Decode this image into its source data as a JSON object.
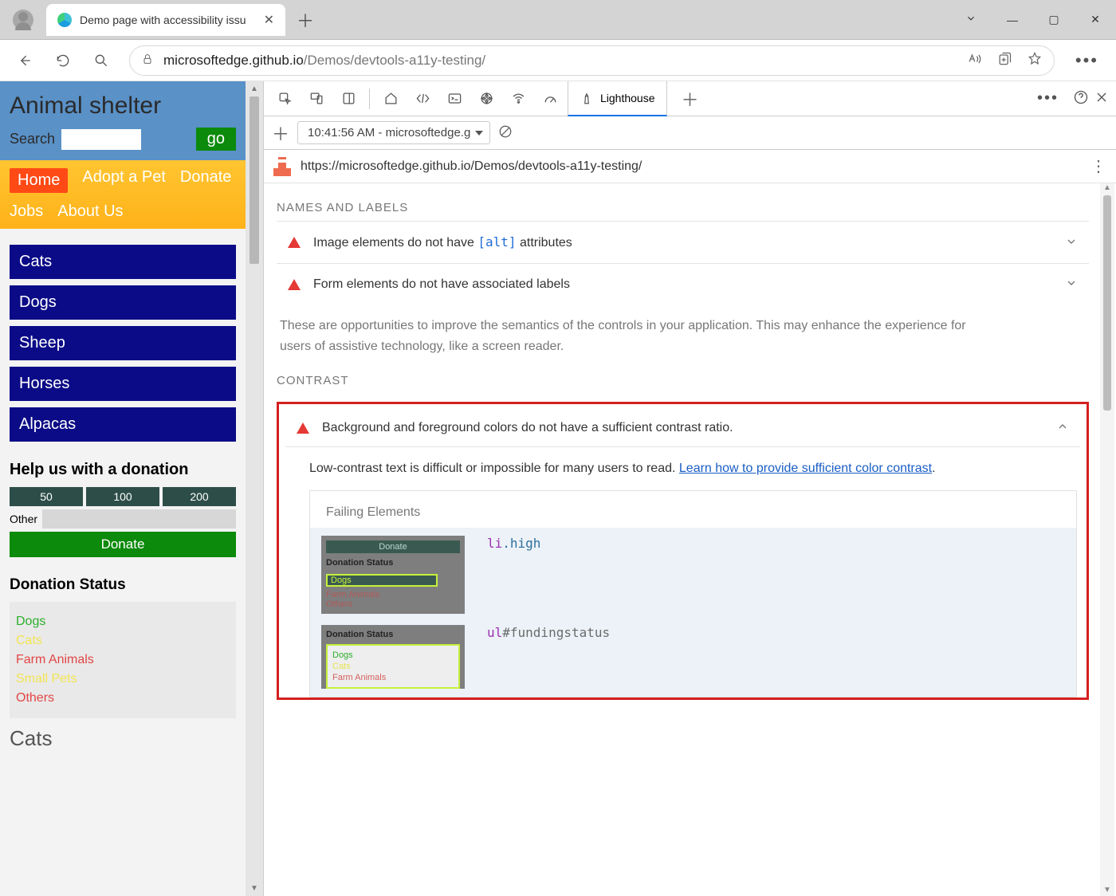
{
  "window": {
    "tab_title": "Demo page with accessibility issu",
    "url_prefix": "microsoftedge.github.io",
    "url_rest": "/Demos/devtools-a11y-testing/"
  },
  "page": {
    "title": "Animal shelter",
    "search_label": "Search",
    "go": "go",
    "nav": {
      "home": "Home",
      "adopt": "Adopt a Pet",
      "donate": "Donate",
      "jobs": "Jobs",
      "about": "About Us"
    },
    "categories": [
      "Cats",
      "Dogs",
      "Sheep",
      "Horses",
      "Alpacas"
    ],
    "donation": {
      "heading": "Help us with a donation",
      "amounts": [
        "50",
        "100",
        "200"
      ],
      "other": "Other",
      "button": "Donate"
    },
    "status": {
      "heading": "Donation Status",
      "items": [
        {
          "label": "Dogs",
          "cls": "s-green"
        },
        {
          "label": "Cats",
          "cls": "s-yellow"
        },
        {
          "label": "Farm Animals",
          "cls": "s-red"
        },
        {
          "label": "Small Pets",
          "cls": "s-yellow"
        },
        {
          "label": "Others",
          "cls": "s-red"
        }
      ]
    },
    "cut": "Cats"
  },
  "devtools": {
    "lighthouse_tab": "Lighthouse",
    "run_label": "10:41:56 AM - microsoftedge.g",
    "report_url": "https://microsoftedge.github.io/Demos/devtools-a11y-testing/",
    "section_names": "NAMES AND LABELS",
    "audit_alt_pre": "Image elements do not have ",
    "audit_alt_code": "[alt]",
    "audit_alt_post": " attributes",
    "audit_form": "Form elements do not have associated labels",
    "names_desc": "These are opportunities to improve the semantics of the controls in your application. This may enhance the experience for users of assistive technology, like a screen reader.",
    "section_contrast": "CONTRAST",
    "contrast_title": "Background and foreground colors do not have a sufficient contrast ratio.",
    "contrast_desc_pre": "Low-contrast text is difficult or impossible for many users to read. ",
    "contrast_link": "Learn how to provide sufficient color contrast",
    "failing_heading": "Failing Elements",
    "sel1": {
      "tag": "li",
      "cls": ".high"
    },
    "sel2": {
      "tag": "ul",
      "id": "#fundingstatus"
    },
    "thumb": {
      "donate": "Donate",
      "dstatus": "Donation Status",
      "dogs": "Dogs",
      "farm": "Farm Animals",
      "others": "Others",
      "cats": "Cats"
    }
  }
}
